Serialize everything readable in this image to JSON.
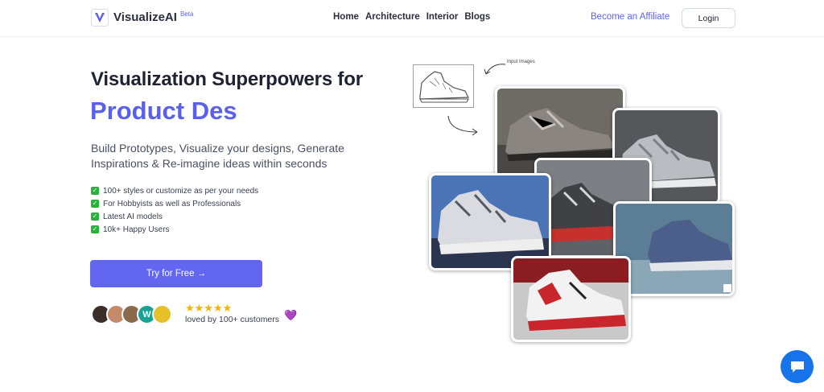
{
  "nav": {
    "logo_name": "VisualizeAI",
    "logo_badge": "Beta",
    "links": [
      "Home",
      "Architecture",
      "Interior",
      "Blogs"
    ],
    "affiliate": "Become an Affiliate",
    "login": "Login"
  },
  "hero": {
    "title_line1": "Visualization Superpowers for",
    "title_line2": "Product Des",
    "subtitle": "Build Prototypes, Visualize your designs, Generate Inspirations & Re-imagine ideas within seconds",
    "features": [
      "100+ styles or customize as per your needs",
      "For Hobbyists as well as Professionals",
      "Latest AI models",
      "10k+ Happy Users"
    ],
    "cta": "Try for Free →",
    "rating_stars": "★★★★★",
    "loved_text": "loved by 100+ customers",
    "heart": "💜"
  },
  "collage": {
    "input_label": "Input Images"
  },
  "colors": {
    "accent": "#6266f1",
    "title_accent": "#5b5ff0",
    "check": "#25b33a",
    "chat": "#1673ea"
  }
}
